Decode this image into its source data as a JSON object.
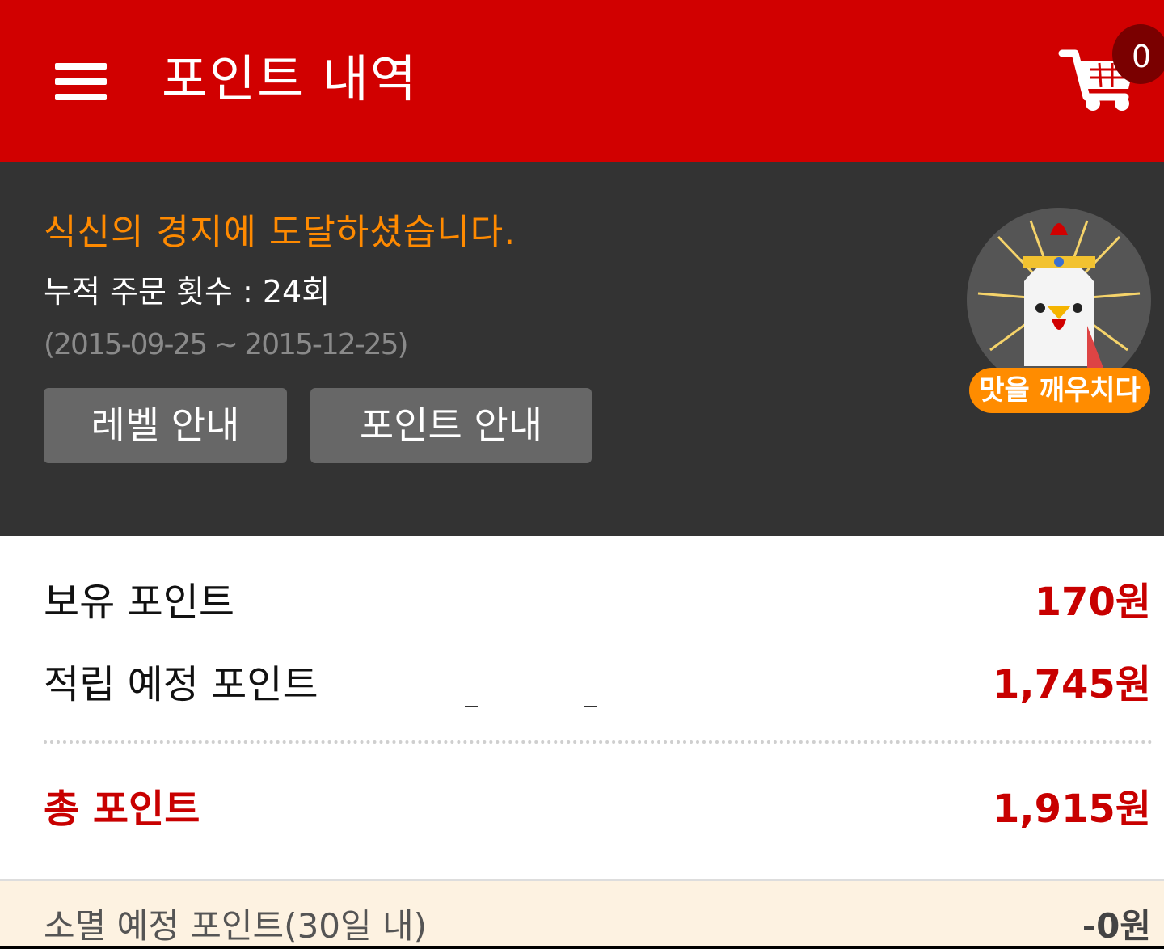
{
  "header": {
    "title": "포인트 내역",
    "cart_count": "0"
  },
  "level": {
    "title": "식신의 경지에 도달하셨습니다.",
    "order_count": "누적 주문 횟수 : 24회",
    "period": "(2015-09-25 ~ 2015-12-25)",
    "level_button": "레벨 안내",
    "point_button": "포인트 안내",
    "badge_label": "맛을 깨우치다"
  },
  "points": {
    "owned_label": "보유 포인트",
    "owned_value": "170원",
    "pending_label": "적립 예정 포인트",
    "pending_value": "1,745원",
    "total_label": "총 포인트",
    "total_value": "1,915원"
  },
  "expire": {
    "label": "소멸 예정 포인트(30일 내)",
    "value": "-0원"
  },
  "colors": {
    "brand_red": "#d10000",
    "accent_orange": "#ff8a00",
    "panel_dark": "#333333"
  },
  "icons": [
    "menu-icon",
    "cart-icon",
    "chicken-badge-icon"
  ]
}
